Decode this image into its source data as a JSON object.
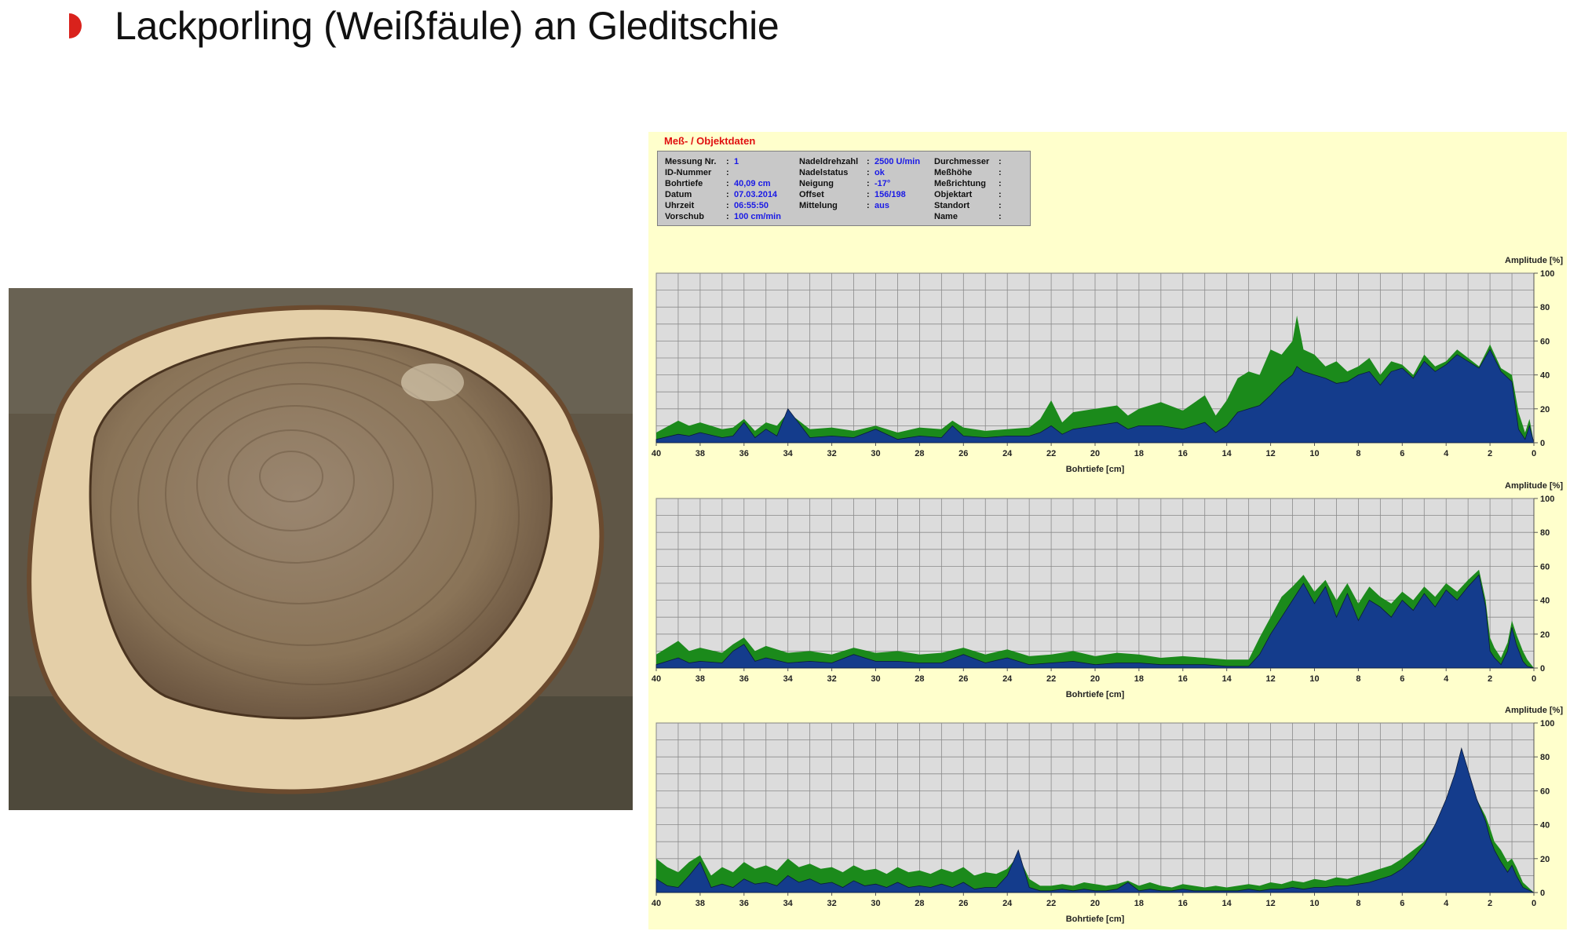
{
  "title": "Lackporling (Weißfäule) an Gleditschie",
  "colors": {
    "accent": "#d9221c",
    "panel_bg": "#ffffcc",
    "plot_bg": "#dcdcdc",
    "green": "#1b8a1b",
    "blue": "#143c8c",
    "label_red": "#e01010",
    "value_blue": "#1a1ae6"
  },
  "icons": {
    "bullet": "red-half-disc-icon"
  },
  "photo": {
    "description_icon": "tree-stump-photo"
  },
  "panel": {
    "title": "Meß- / Objektdaten",
    "col1": [
      {
        "label": "Messung Nr.",
        "value": "1"
      },
      {
        "label": "ID-Nummer",
        "value": ""
      },
      {
        "label": "Bohrtiefe",
        "value": "40,09 cm"
      },
      {
        "label": "Datum",
        "value": "07.03.2014"
      },
      {
        "label": "Uhrzeit",
        "value": "06:55:50"
      },
      {
        "label": "Vorschub",
        "value": "100 cm/min"
      }
    ],
    "col2": [
      {
        "label": "Nadeldrehzahl",
        "value": "2500 U/min"
      },
      {
        "label": "Nadelstatus",
        "value": "ok"
      },
      {
        "label": "Neigung",
        "value": "-17°"
      },
      {
        "label": "Offset",
        "value": "156/198"
      },
      {
        "label": "Mittelung",
        "value": "aus"
      }
    ],
    "col3": [
      {
        "label": "Durchmesser",
        "value": ""
      },
      {
        "label": "Meßhöhe",
        "value": ""
      },
      {
        "label": "Meßrichtung",
        "value": ""
      },
      {
        "label": "Objektart",
        "value": ""
      },
      {
        "label": "Standort",
        "value": ""
      },
      {
        "label": "Name",
        "value": ""
      }
    ]
  },
  "chart_data": [
    {
      "type": "area",
      "xlabel": "Bohrtiefe [cm]",
      "ylabel": "Amplitude [%]",
      "xlim": [
        40,
        0
      ],
      "ylim": [
        0,
        100
      ],
      "xticks": [
        40,
        38,
        36,
        34,
        32,
        30,
        28,
        26,
        24,
        22,
        20,
        18,
        16,
        14,
        12,
        10,
        8,
        6,
        4,
        2,
        0
      ],
      "yticks": [
        0,
        20,
        40,
        60,
        80,
        100
      ],
      "grid": true,
      "series": [
        {
          "color": "#1b8a1b",
          "x": [
            40,
            39,
            38.5,
            38,
            37,
            36.5,
            36,
            35.5,
            35,
            34.5,
            34,
            33,
            32,
            31,
            30,
            29,
            28,
            27,
            26.5,
            26,
            25,
            24,
            23,
            22.5,
            22,
            21.5,
            21,
            20,
            19,
            18.5,
            18,
            17,
            16,
            15,
            14.5,
            14,
            13.5,
            13,
            12.5,
            12,
            11.5,
            11,
            10.8,
            10.5,
            10,
            9.5,
            9,
            8.5,
            8,
            7.5,
            7,
            6.5,
            6,
            5.5,
            5,
            4.5,
            4,
            3.5,
            3,
            2.5,
            2,
            1.5,
            1,
            0.7,
            0.4,
            0.2,
            0
          ],
          "y": [
            6,
            13,
            10,
            12,
            8,
            9,
            14,
            7,
            12,
            10,
            18,
            8,
            9,
            7,
            10,
            6,
            9,
            8,
            13,
            9,
            7,
            8,
            9,
            14,
            25,
            12,
            18,
            20,
            22,
            16,
            20,
            24,
            19,
            28,
            16,
            25,
            38,
            42,
            40,
            55,
            52,
            60,
            75,
            55,
            52,
            45,
            48,
            42,
            45,
            50,
            40,
            48,
            46,
            40,
            52,
            45,
            48,
            55,
            50,
            45,
            58,
            44,
            40,
            18,
            6,
            14,
            0
          ]
        },
        {
          "color": "#143c8c",
          "x": [
            40,
            39,
            38.5,
            38,
            37,
            36.5,
            36,
            35.5,
            35,
            34.5,
            34,
            33,
            32,
            31,
            30,
            29,
            28,
            27,
            26.5,
            26,
            25,
            24,
            23,
            22.5,
            22,
            21.5,
            21,
            20,
            19,
            18.5,
            18,
            17,
            16,
            15,
            14.5,
            14,
            13.5,
            13,
            12.5,
            12,
            11.5,
            11,
            10.8,
            10.5,
            10,
            9.5,
            9,
            8.5,
            8,
            7.5,
            7,
            6.5,
            6,
            5.5,
            5,
            4.5,
            4,
            3.5,
            3,
            2.5,
            2,
            1.5,
            1,
            0.7,
            0.4,
            0.2,
            0
          ],
          "y": [
            2,
            5,
            4,
            6,
            3,
            4,
            12,
            3,
            8,
            4,
            20,
            3,
            4,
            3,
            8,
            2,
            4,
            3,
            10,
            4,
            3,
            4,
            4,
            6,
            10,
            5,
            8,
            10,
            12,
            8,
            10,
            10,
            8,
            12,
            6,
            10,
            18,
            20,
            22,
            28,
            35,
            40,
            45,
            42,
            40,
            38,
            35,
            36,
            40,
            42,
            34,
            42,
            44,
            38,
            48,
            42,
            46,
            52,
            48,
            44,
            55,
            42,
            36,
            8,
            2,
            10,
            0
          ]
        }
      ]
    },
    {
      "type": "area",
      "xlabel": "Bohrtiefe [cm]",
      "ylabel": "Amplitude [%]",
      "xlim": [
        40,
        0
      ],
      "ylim": [
        0,
        100
      ],
      "xticks": [
        40,
        38,
        36,
        34,
        32,
        30,
        28,
        26,
        24,
        22,
        20,
        18,
        16,
        14,
        12,
        10,
        8,
        6,
        4,
        2,
        0
      ],
      "yticks": [
        0,
        20,
        40,
        60,
        80,
        100
      ],
      "grid": true,
      "series": [
        {
          "color": "#1b8a1b",
          "x": [
            40,
            39,
            38.5,
            38,
            37,
            36.5,
            36,
            35.5,
            35,
            34,
            33,
            32,
            31,
            30,
            29,
            28,
            27,
            26,
            25,
            24,
            23,
            22,
            21,
            20,
            19,
            18,
            17,
            16,
            15,
            14,
            13,
            12.5,
            12,
            11.5,
            11,
            10.5,
            10,
            9.5,
            9,
            8.5,
            8,
            7.5,
            7,
            6.5,
            6,
            5.5,
            5,
            4.5,
            4,
            3.5,
            3,
            2.5,
            2.2,
            2,
            1.8,
            1.5,
            1.2,
            1,
            0.8,
            0.5,
            0.3,
            0
          ],
          "y": [
            8,
            16,
            10,
            12,
            9,
            14,
            18,
            10,
            13,
            9,
            10,
            8,
            12,
            9,
            10,
            8,
            9,
            12,
            8,
            11,
            7,
            8,
            10,
            7,
            9,
            8,
            6,
            7,
            6,
            5,
            5,
            18,
            30,
            42,
            48,
            55,
            45,
            52,
            40,
            50,
            38,
            48,
            42,
            38,
            45,
            40,
            48,
            42,
            50,
            45,
            52,
            58,
            40,
            18,
            12,
            6,
            15,
            28,
            20,
            10,
            5,
            0
          ]
        },
        {
          "color": "#143c8c",
          "x": [
            40,
            39,
            38.5,
            38,
            37,
            36.5,
            36,
            35.5,
            35,
            34,
            33,
            32,
            31,
            30,
            29,
            28,
            27,
            26,
            25,
            24,
            23,
            22,
            21,
            20,
            19,
            18,
            17,
            16,
            15,
            14,
            13,
            12.5,
            12,
            11.5,
            11,
            10.5,
            10,
            9.5,
            9,
            8.5,
            8,
            7.5,
            7,
            6.5,
            6,
            5.5,
            5,
            4.5,
            4,
            3.5,
            3,
            2.5,
            2.2,
            2,
            1.8,
            1.5,
            1.2,
            1,
            0.8,
            0.5,
            0.3,
            0
          ],
          "y": [
            2,
            6,
            3,
            4,
            3,
            10,
            14,
            4,
            6,
            3,
            4,
            3,
            8,
            4,
            4,
            3,
            3,
            8,
            3,
            6,
            2,
            3,
            4,
            2,
            3,
            3,
            2,
            2,
            2,
            1,
            1,
            8,
            20,
            30,
            40,
            50,
            38,
            48,
            30,
            44,
            28,
            40,
            36,
            30,
            40,
            34,
            44,
            36,
            46,
            40,
            48,
            55,
            36,
            10,
            6,
            2,
            10,
            24,
            14,
            4,
            1,
            0
          ]
        }
      ]
    },
    {
      "type": "area",
      "xlabel": "Bohrtiefe [cm]",
      "ylabel": "Amplitude [%]",
      "xlim": [
        40,
        0
      ],
      "ylim": [
        0,
        100
      ],
      "xticks": [
        40,
        38,
        36,
        34,
        32,
        30,
        28,
        26,
        24,
        22,
        20,
        18,
        16,
        14,
        12,
        10,
        8,
        6,
        4,
        2,
        0
      ],
      "yticks": [
        0,
        20,
        40,
        60,
        80,
        100
      ],
      "grid": true,
      "series": [
        {
          "color": "#1b8a1b",
          "x": [
            40,
            39.5,
            39,
            38.5,
            38,
            37.5,
            37,
            36.5,
            36,
            35.5,
            35,
            34.5,
            34,
            33.5,
            33,
            32.5,
            32,
            31.5,
            31,
            30.5,
            30,
            29.5,
            29,
            28.5,
            28,
            27.5,
            27,
            26.5,
            26,
            25.5,
            25,
            24.5,
            24,
            23.5,
            23,
            22.5,
            22,
            21.5,
            21,
            20.5,
            20,
            19.5,
            19,
            18.5,
            18,
            17.5,
            17,
            16.5,
            16,
            15.5,
            15,
            14.5,
            14,
            13.5,
            13,
            12.5,
            12,
            11.5,
            11,
            10.5,
            10,
            9.5,
            9,
            8.5,
            8,
            7.5,
            7,
            6.5,
            6,
            5.5,
            5,
            4.5,
            4,
            3.6,
            3.3,
            3,
            2.6,
            2.2,
            2,
            1.8,
            1.5,
            1.2,
            1,
            0.8,
            0.5,
            0
          ],
          "y": [
            20,
            15,
            12,
            18,
            22,
            10,
            15,
            12,
            18,
            14,
            16,
            13,
            20,
            15,
            17,
            14,
            15,
            12,
            16,
            13,
            14,
            11,
            15,
            12,
            13,
            11,
            14,
            12,
            15,
            10,
            12,
            11,
            14,
            22,
            8,
            4,
            4,
            5,
            4,
            6,
            5,
            4,
            5,
            7,
            4,
            6,
            4,
            3,
            5,
            4,
            3,
            4,
            3,
            4,
            5,
            4,
            6,
            5,
            7,
            6,
            8,
            7,
            9,
            8,
            10,
            12,
            14,
            16,
            20,
            25,
            30,
            40,
            55,
            65,
            75,
            68,
            55,
            45,
            38,
            30,
            25,
            18,
            20,
            15,
            6,
            0
          ]
        },
        {
          "color": "#143c8c",
          "x": [
            40,
            39.5,
            39,
            38.5,
            38,
            37.5,
            37,
            36.5,
            36,
            35.5,
            35,
            34.5,
            34,
            33.5,
            33,
            32.5,
            32,
            31.5,
            31,
            30.5,
            30,
            29.5,
            29,
            28.5,
            28,
            27.5,
            27,
            26.5,
            26,
            25.5,
            25,
            24.5,
            24,
            23.5,
            23,
            22.5,
            22,
            21.5,
            21,
            20.5,
            20,
            19.5,
            19,
            18.5,
            18,
            17.5,
            17,
            16.5,
            16,
            15.5,
            15,
            14.5,
            14,
            13.5,
            13,
            12.5,
            12,
            11.5,
            11,
            10.5,
            10,
            9.5,
            9,
            8.5,
            8,
            7.5,
            7,
            6.5,
            6,
            5.5,
            5,
            4.5,
            4,
            3.6,
            3.3,
            3,
            2.6,
            2.2,
            2,
            1.8,
            1.5,
            1.2,
            1,
            0.8,
            0.5,
            0
          ],
          "y": [
            8,
            4,
            3,
            10,
            18,
            3,
            5,
            3,
            8,
            5,
            6,
            4,
            10,
            6,
            8,
            5,
            6,
            3,
            7,
            4,
            5,
            3,
            6,
            3,
            4,
            3,
            5,
            3,
            6,
            2,
            3,
            3,
            10,
            25,
            3,
            1,
            1,
            2,
            1,
            2,
            1,
            1,
            2,
            6,
            1,
            2,
            1,
            1,
            2,
            1,
            1,
            1,
            1,
            1,
            2,
            1,
            2,
            2,
            3,
            2,
            3,
            3,
            4,
            4,
            5,
            6,
            8,
            10,
            14,
            20,
            28,
            40,
            55,
            70,
            85,
            72,
            55,
            42,
            32,
            25,
            18,
            12,
            16,
            10,
            3,
            0
          ]
        }
      ]
    }
  ]
}
